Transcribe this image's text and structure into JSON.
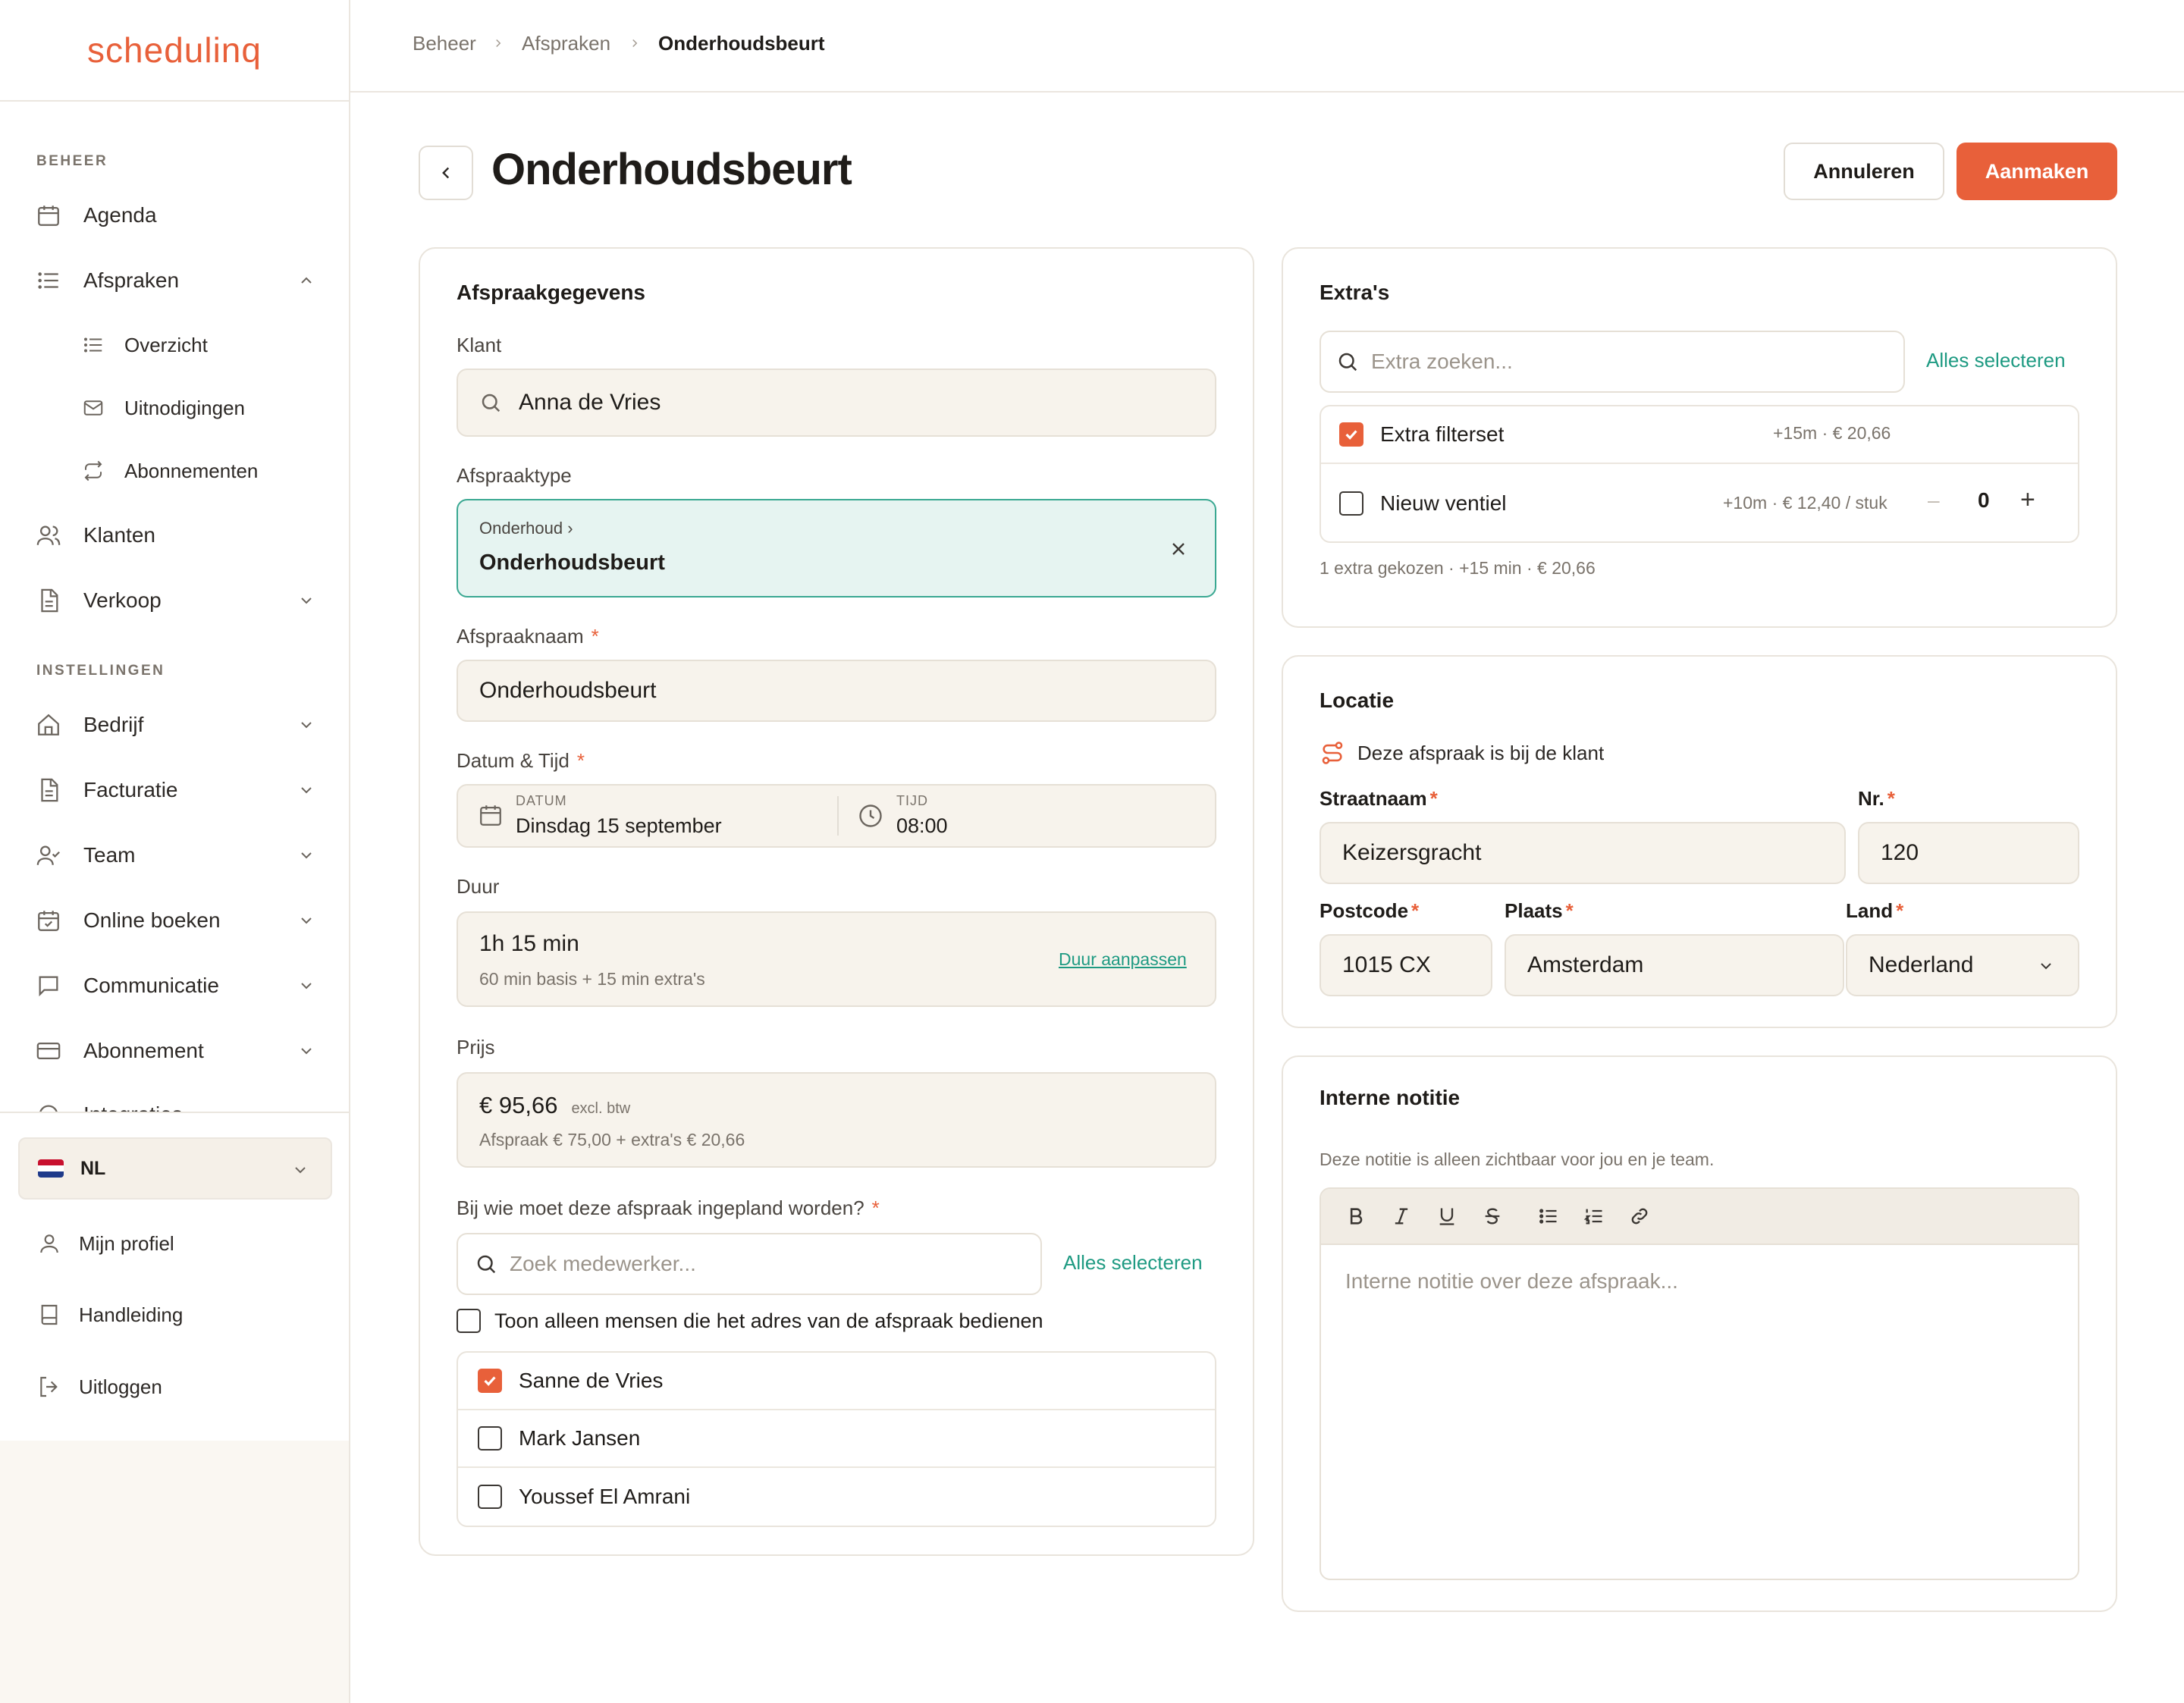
{
  "app": {
    "logo": "schedulinq"
  },
  "sidebar": {
    "section_beheer": "BEHEER",
    "section_instellingen": "INSTELLINGEN",
    "items": {
      "agenda": "Agenda",
      "afspraken": "Afspraken",
      "overzicht": "Overzicht",
      "uitnodigingen": "Uitnodigingen",
      "abonnementen": "Abonnementen",
      "klanten": "Klanten",
      "verkoop": "Verkoop",
      "bedrijf": "Bedrijf",
      "facturatie": "Facturatie",
      "team": "Team",
      "online_boeken": "Online boeken",
      "communicatie": "Communicatie",
      "abonnement": "Abonnement",
      "integraties_cut": "Integraties"
    },
    "language": "NL",
    "bottom": {
      "profiel": "Mijn profiel",
      "handleiding": "Handleiding",
      "uitloggen": "Uitloggen"
    }
  },
  "breadcrumb": [
    "Beheer",
    "Afspraken",
    "Onderhoudsbeurt"
  ],
  "header": {
    "title": "Onderhoudsbeurt",
    "cancel_label": "Annuleren",
    "create_label": "Aanmaken"
  },
  "details": {
    "title": "Afspraakgegevens",
    "klant_label": "Klant",
    "klant_value": "Anna de Vries",
    "type_label": "Afspraaktype",
    "type_parent": "Onderhoud ›",
    "type_value": "Onderhoudsbeurt",
    "naam_label": "Afspraaknaam",
    "naam_value": "Onderhoudsbeurt",
    "datetime_label": "Datum & Tijd",
    "datum_caption": "DATUM",
    "datum_value": "Dinsdag 15 september",
    "tijd_caption": "TIJD",
    "tijd_value": "08:00",
    "duur_label": "Duur",
    "duur_value": "1h 15 min",
    "duur_sub": "60 min basis + 15 min extra's",
    "duur_link": "Duur aanpassen",
    "prijs_label": "Prijs",
    "prijs_value": "€ 95,66",
    "prijs_excl": "excl. btw",
    "prijs_sub": "Afspraak € 75,00 + extra's € 20,66",
    "assign_label": "Bij wie moet deze afspraak ingepland worden?",
    "assign_search_placeholder": "Zoek medewerker...",
    "assign_select_all": "Alles selecteren",
    "assign_filter": "Toon alleen mensen die het adres van de afspraak bedienen",
    "employees": [
      {
        "name": "Sanne de Vries",
        "checked": true
      },
      {
        "name": "Mark Jansen",
        "checked": false
      },
      {
        "name": "Youssef El Amrani",
        "checked": false
      }
    ]
  },
  "extras": {
    "title": "Extra's",
    "search_placeholder": "Extra zoeken...",
    "select_all": "Alles selecteren",
    "items": [
      {
        "name": "Extra filterset",
        "meta": "+15m · € 20,66",
        "checked": true
      },
      {
        "name": "Nieuw ventiel",
        "meta": "+10m · € 12,40 / stuk",
        "checked": false,
        "qty": "0",
        "minus": "–",
        "plus": "+"
      }
    ],
    "summary": "1 extra gekozen · +15 min · € 20,66"
  },
  "locatie": {
    "title": "Locatie",
    "note": "Deze afspraak is bij de klant",
    "straat_label": "Straatnaam",
    "straat_value": "Keizersgracht",
    "nr_label": "Nr.",
    "nr_value": "120",
    "postcode_label": "Postcode",
    "postcode_value": "1015 CX",
    "plaats_label": "Plaats",
    "plaats_value": "Amsterdam",
    "land_label": "Land",
    "land_value": "Nederland"
  },
  "notitie": {
    "title": "Interne notitie",
    "hint": "Deze notitie is alleen zichtbaar voor jou en je team.",
    "placeholder": "Interne notitie over deze afspraak..."
  },
  "colors": {
    "accent": "#e8603a",
    "teal": "#1e9a82",
    "type_bg": "#e6f4f1"
  }
}
